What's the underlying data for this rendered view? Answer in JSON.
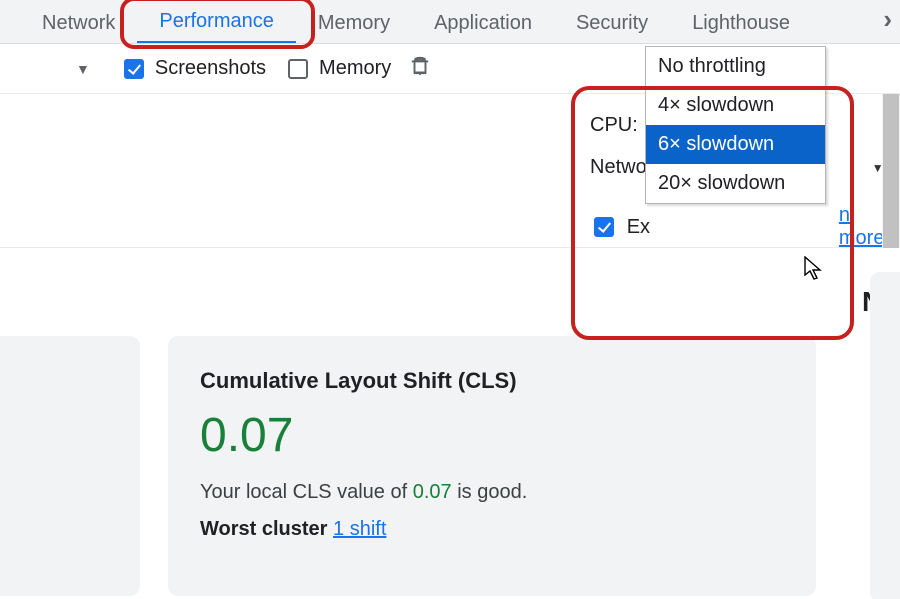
{
  "tabs": {
    "network": "Network",
    "performance": "Performance",
    "memory": "Memory",
    "application": "Application",
    "security": "Security",
    "lighthouse": "Lighthouse"
  },
  "toolbar": {
    "screenshots_label": "Screenshots",
    "memory_label": "Memory"
  },
  "settings": {
    "cpu_label": "CPU:",
    "cpu_selected": "No throttling",
    "cpu_options": {
      "none": "No throttling",
      "x4": "4× slowdown",
      "x6": "6× slowdown",
      "x20": "20× slowdown"
    },
    "network_label_partial": "Netwo",
    "extension_label_partial": "Ex",
    "learn_more_partial": "n more"
  },
  "card_right": {
    "heading_partial": "Ne"
  },
  "card_mid": {
    "title": "Cumulative Layout Shift (CLS)",
    "value": "0.07",
    "text_pre": "Your local CLS value of ",
    "text_val": "0.07",
    "text_post": " is good.",
    "worst_label": "Worst cluster",
    "worst_link": "1 shift"
  }
}
